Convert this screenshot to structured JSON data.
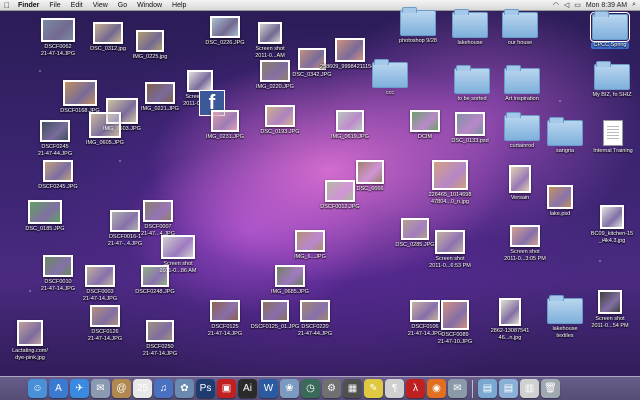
{
  "menubar": {
    "apple": "",
    "items": [
      "Finder",
      "File",
      "Edit",
      "View",
      "Go",
      "Window",
      "Help"
    ],
    "clock": "Mon 8:39 AM"
  },
  "desktop_items": [
    {
      "kind": "photo",
      "label": "DSCF0062\n21-47-14.JPG",
      "color": "#7a8aa0"
    },
    {
      "kind": "photo",
      "label": "DSC_0312.jpg",
      "color": "#c8b090"
    },
    {
      "kind": "photo",
      "label": "IMG_0225.jpg",
      "color": "#b0a070"
    },
    {
      "kind": "photo",
      "label": "DSC_0226.JPG",
      "color": "#a8c0d0"
    },
    {
      "kind": "photo",
      "label": "Screen shot\n2011-0...AM",
      "color": "#d0d0d0"
    },
    {
      "kind": "photo",
      "label": "DSC_0342.JPG",
      "color": "#c09080"
    },
    {
      "kind": "photo",
      "label": "258609_99984211154_..47.jpg",
      "color": "#d09080"
    },
    {
      "kind": "folder",
      "label": "photoshop 9/28"
    },
    {
      "kind": "folder",
      "label": "lakehouse"
    },
    {
      "kind": "folder",
      "label": "our house"
    },
    {
      "kind": "folder",
      "label": "CPCC Spring",
      "selected": true
    },
    {
      "kind": "photo",
      "label": "DSCF0168.JPG",
      "color": "#c09060"
    },
    {
      "kind": "photo",
      "label": "IMG_0603.JPG",
      "color": "#d0c0a0"
    },
    {
      "kind": "photo",
      "label": "IMG_0221.JPG",
      "color": "#806050"
    },
    {
      "kind": "photo",
      "label": "Screen shot\n2011-0...4 AM",
      "color": "#e0e0e0"
    },
    {
      "kind": "fb",
      "label": ""
    },
    {
      "kind": "photo",
      "label": "IMG_0220.JPG",
      "color": "#908070"
    },
    {
      "kind": "folder",
      "label": "ccc"
    },
    {
      "kind": "folder",
      "label": "to be sorted"
    },
    {
      "kind": "folder",
      "label": "Art inspiration"
    },
    {
      "kind": "folder",
      "label": "My BIZ, fo SHIZ"
    },
    {
      "kind": "photo",
      "label": "DSCF0245\n21-47-44.JPG",
      "color": "#405060"
    },
    {
      "kind": "photo",
      "label": "IMG_0605.JPG",
      "color": "#c8b8a0"
    },
    {
      "kind": "photo",
      "label": "IMG_0231.JPG",
      "color": "#e0a0b0"
    },
    {
      "kind": "photo",
      "label": "DSC_0193.JPG",
      "color": "#d0b090"
    },
    {
      "kind": "photo",
      "label": "IMG_0619.JPG",
      "color": "#b8c8c0"
    },
    {
      "kind": "photo",
      "label": "DCIM",
      "color": "#70a070"
    },
    {
      "kind": "photo",
      "label": "DSC_0133.psd",
      "color": "#8090a0"
    },
    {
      "kind": "folder",
      "label": "curtainrod"
    },
    {
      "kind": "folder",
      "label": "sangria"
    },
    {
      "kind": "doc",
      "label": "Internal Training"
    },
    {
      "kind": "photo",
      "label": "DSCF0245.JPG",
      "color": "#c0a080"
    },
    {
      "kind": "photo",
      "label": "DSC_0185.JPG",
      "color": "#60a060"
    },
    {
      "kind": "photo",
      "label": "DSCF0016-1\n21-47-..4.JPG",
      "color": "#b0b0b0"
    },
    {
      "kind": "photo",
      "label": "DSCF0007\n21-47...4.JPG",
      "color": "#908070"
    },
    {
      "kind": "photo",
      "label": "Screen shot\n2011-0...86 AM",
      "color": "#d0d0d0"
    },
    {
      "kind": "photo",
      "label": "IMG_6...JPG",
      "color": "#b09070"
    },
    {
      "kind": "photo",
      "label": "DSC_6666",
      "color": "#a08070"
    },
    {
      "kind": "photo",
      "label": "226465_1014698\n47804...0_n.jpg",
      "color": "#d0a080"
    },
    {
      "kind": "photo",
      "label": "Versain",
      "color": "#e0d0b0"
    },
    {
      "kind": "photo",
      "label": "lake.psd",
      "color": "#c09060"
    },
    {
      "kind": "photo",
      "label": "DSCF0010\n21-47-14.JPG",
      "color": "#6a8a60"
    },
    {
      "kind": "photo",
      "label": "DSCF0003\n21-47-14.JPG",
      "color": "#c0b0a0"
    },
    {
      "kind": "photo",
      "label": "DSCF0248.JPG",
      "color": "#90b080"
    },
    {
      "kind": "photo",
      "label": "IMG_0685.JPG",
      "color": "#708060"
    },
    {
      "kind": "photo",
      "label": "DSC_0285.JPG",
      "color": "#b0a090"
    },
    {
      "kind": "photo",
      "label": "Screen shot\n2011-0...6:53 PM",
      "color": "#c0b0a0"
    },
    {
      "kind": "photo",
      "label": "Screen shot\n2011-0...3:05 PM",
      "color": "#d0a090"
    },
    {
      "kind": "photo",
      "label": "BC09_kitchen-15\n_i4k4.3.jpg",
      "color": "#e0e0e0"
    },
    {
      "kind": "photo",
      "label": "DSCF0126\n21-47-14.JPG",
      "color": "#b09080"
    },
    {
      "kind": "photo",
      "label": "DSCF0250\n21-47-14.JPG",
      "color": "#a09080"
    },
    {
      "kind": "photo",
      "label": "DSCF0125\n21-47-14.JPG",
      "color": "#906050"
    },
    {
      "kind": "photo",
      "label": "DSCF0125_01.JPG",
      "color": "#8a7060"
    },
    {
      "kind": "photo",
      "label": "DSCF0220\n21-47-44.JPG",
      "color": "#a08870"
    },
    {
      "kind": "photo",
      "label": "DSCF0106\n21-47-14.JPG",
      "color": "#c8b0a0"
    },
    {
      "kind": "photo",
      "label": "DSCF0089\n21-47-10.JPG",
      "color": "#d09080"
    },
    {
      "kind": "photo",
      "label": "2862-13087541\n46...n.jpg",
      "color": "#e0e0d0"
    },
    {
      "kind": "folder",
      "label": "lakehouse\ntextiles"
    },
    {
      "kind": "photo",
      "label": "Screen shot\n2011-0...54 PM",
      "color": "#404040"
    },
    {
      "kind": "photo",
      "label": "Lactating.com/\ndye-pink.jpg",
      "color": "#c0a0a0"
    },
    {
      "kind": "photo",
      "label": "DSCF0012.JPG",
      "color": "#b0b8a0"
    }
  ],
  "dock": {
    "icons": [
      {
        "name": "finder-icon",
        "glyph": "☺",
        "color": "#4a90d8"
      },
      {
        "name": "app-store-icon",
        "glyph": "A",
        "color": "#3a7ad0"
      },
      {
        "name": "safari-icon",
        "glyph": "✈",
        "color": "#3a8ae0"
      },
      {
        "name": "mail-icon",
        "glyph": "✉",
        "color": "#8a9ab0"
      },
      {
        "name": "address-book-icon",
        "glyph": "@",
        "color": "#b08850"
      },
      {
        "name": "ical-icon",
        "glyph": "25",
        "color": "#e8e8e8"
      },
      {
        "name": "itunes-icon",
        "glyph": "♫",
        "color": "#4a70c0"
      },
      {
        "name": "iphoto-icon",
        "glyph": "✿",
        "color": "#6a8ab0"
      },
      {
        "name": "photoshop-icon",
        "glyph": "Ps",
        "color": "#1e3c70"
      },
      {
        "name": "photobooth-icon",
        "glyph": "▣",
        "color": "#c02020"
      },
      {
        "name": "illustrator-icon",
        "glyph": "Ai",
        "color": "#2a2a2a"
      },
      {
        "name": "word-icon",
        "glyph": "W",
        "color": "#2a5aa0"
      },
      {
        "name": "preview-icon",
        "glyph": "❀",
        "color": "#7a9ac0"
      },
      {
        "name": "time-machine-icon",
        "glyph": "◷",
        "color": "#3a6a5a"
      },
      {
        "name": "system-preferences-icon",
        "glyph": "⚙",
        "color": "#707070"
      },
      {
        "name": "calculator-icon",
        "glyph": "▦",
        "color": "#505050"
      },
      {
        "name": "stickies-icon",
        "glyph": "✎",
        "color": "#e0c840"
      },
      {
        "name": "textedit-icon",
        "glyph": "¶",
        "color": "#d0d0d0"
      },
      {
        "name": "acrobat-icon",
        "glyph": "λ",
        "color": "#c02020"
      },
      {
        "name": "firefox-icon",
        "glyph": "◉",
        "color": "#e07020"
      },
      {
        "name": "mail-app-icon",
        "glyph": "✉",
        "color": "#8a9aa8"
      }
    ],
    "right_icons": [
      {
        "name": "applications-folder-icon",
        "glyph": "▤",
        "color": "#7aa8d0"
      },
      {
        "name": "documents-folder-icon",
        "glyph": "▤",
        "color": "#8ab0d8"
      },
      {
        "name": "downloads-stack-icon",
        "glyph": "▥",
        "color": "#d0d0d0"
      },
      {
        "name": "trash-icon",
        "glyph": "🗑",
        "color": "#a0a8b0"
      }
    ]
  }
}
